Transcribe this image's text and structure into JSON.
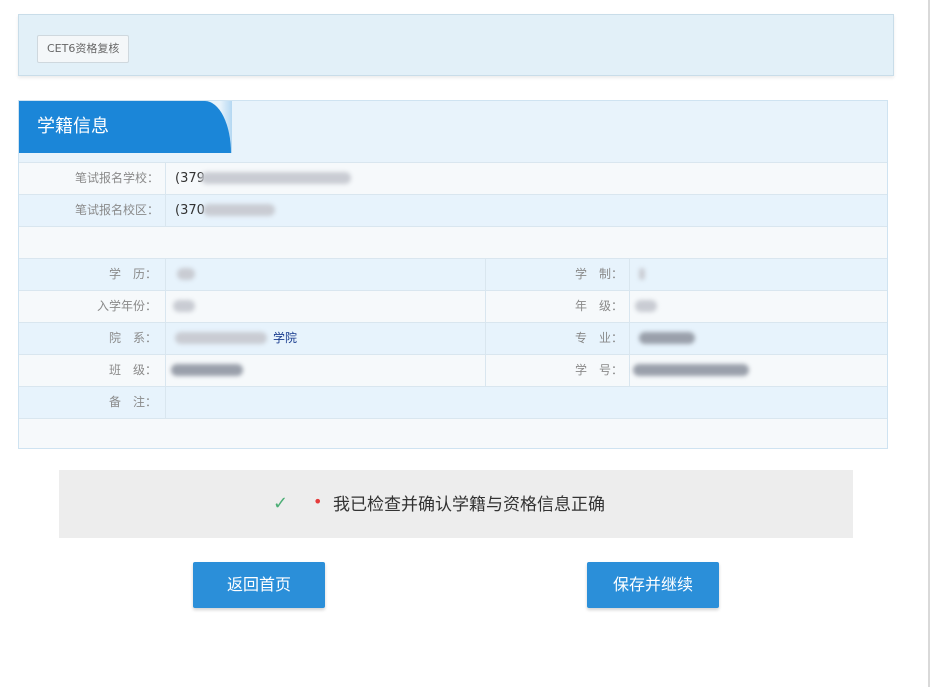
{
  "header": {
    "chip_label": "CET6资格复核"
  },
  "panel": {
    "title": "学籍信息",
    "rows": [
      {
        "label": "笔试报名学校：",
        "value": "(379"
      },
      {
        "label": "笔试报名校区：",
        "value": "(370"
      }
    ],
    "grid": {
      "left_labels": [
        "学　历：",
        "入学年份：",
        "院　系：",
        "班　级：",
        "备　注："
      ],
      "right_labels": [
        "学　制：",
        "年　级：",
        "专　业：",
        "学　号："
      ],
      "dept_suffix": "学院"
    }
  },
  "confirm": {
    "check_icon": "✓",
    "required_mark": "•",
    "text": "我已检查并确认学籍与资格信息正确"
  },
  "buttons": {
    "home": "返回首页",
    "save": "保存并继续"
  },
  "colors": {
    "accent": "#1b86d8",
    "button": "#2b8fd9",
    "check": "#4cae76",
    "required": "#e53b3b"
  }
}
